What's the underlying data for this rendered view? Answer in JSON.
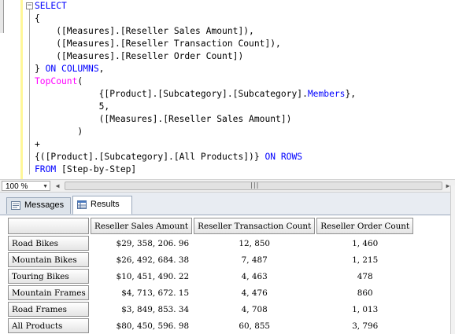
{
  "editor": {
    "lines": [
      [
        {
          "t": "SELECT",
          "c": "kw"
        }
      ],
      [
        {
          "t": "{",
          "c": ""
        }
      ],
      [
        {
          "t": "    ([Measures].[Reseller Sales Amount]),",
          "c": ""
        }
      ],
      [
        {
          "t": "    ([Measures].[Reseller Transaction Count]),",
          "c": ""
        }
      ],
      [
        {
          "t": "    ([Measures].[Reseller Order Count])",
          "c": ""
        }
      ],
      [
        {
          "t": "} ",
          "c": ""
        },
        {
          "t": "ON COLUMNS",
          "c": "kw"
        },
        {
          "t": ",",
          "c": ""
        }
      ],
      [
        {
          "t": "TopCount",
          "c": "fn"
        },
        {
          "t": "(",
          "c": ""
        }
      ],
      [
        {
          "t": "            {[Product].[Subcategory].[Subcategory].",
          "c": ""
        },
        {
          "t": "Members",
          "c": "kw"
        },
        {
          "t": "},",
          "c": ""
        }
      ],
      [
        {
          "t": "            5,",
          "c": ""
        }
      ],
      [
        {
          "t": "            ([Measures].[Reseller Sales Amount])",
          "c": ""
        }
      ],
      [
        {
          "t": "        )",
          "c": ""
        }
      ],
      [
        {
          "t": "+",
          "c": ""
        }
      ],
      [
        {
          "t": "{([Product].[Subcategory].[All Products])} ",
          "c": ""
        },
        {
          "t": "ON ROWS",
          "c": "kw"
        }
      ],
      [
        {
          "t": "FROM ",
          "c": "kw"
        },
        {
          "t": "[Step-by-Step]",
          "c": ""
        }
      ]
    ]
  },
  "zoom": {
    "value": "100 %"
  },
  "scroll": {
    "grip": "|||"
  },
  "tabs": {
    "messages": "Messages",
    "results": "Results"
  },
  "grid": {
    "columns": [
      "Reseller Sales Amount",
      "Reseller Transaction Count",
      "Reseller Order Count"
    ],
    "rows": [
      {
        "label": "Road Bikes",
        "values": [
          "$29, 358, 206. 96",
          "12, 850",
          "1, 460"
        ]
      },
      {
        "label": "Mountain Bikes",
        "values": [
          "$26, 492, 684. 38",
          "7, 487",
          "1, 215"
        ]
      },
      {
        "label": "Touring Bikes",
        "values": [
          "$10, 451, 490. 22",
          "4, 463",
          "478"
        ]
      },
      {
        "label": "Mountain Frames",
        "values": [
          "$4, 713, 672. 15",
          "4, 476",
          "860"
        ]
      },
      {
        "label": "Road Frames",
        "values": [
          "$3, 849, 853. 34",
          "4, 708",
          "1, 013"
        ]
      },
      {
        "label": "All Products",
        "values": [
          "$80, 450, 596. 98",
          "60, 855",
          "3, 796"
        ]
      }
    ]
  },
  "colors": {
    "keyword": "#0000ff",
    "function": "#ff00ff",
    "margin": "#fff799"
  },
  "icons": {
    "messages": "messages-icon",
    "results": "grid-icon",
    "collapse": "collapse-minus-icon"
  }
}
